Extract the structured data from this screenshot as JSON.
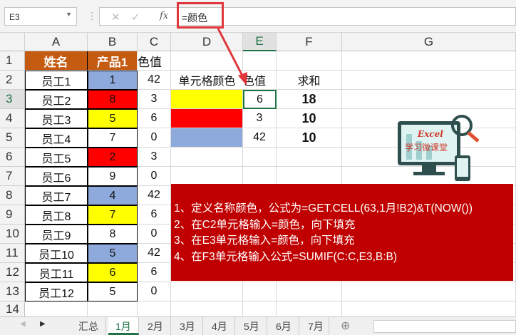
{
  "name_box": "E3",
  "formula": "=颜色",
  "columns": [
    "A",
    "B",
    "C",
    "D",
    "E",
    "F",
    "G"
  ],
  "rows": [
    "1",
    "2",
    "3",
    "4",
    "5",
    "6",
    "7",
    "8",
    "9",
    "10",
    "11",
    "12",
    "13",
    "14"
  ],
  "headers": {
    "name": "姓名",
    "product": "产品1",
    "color_value": "色值"
  },
  "employees": [
    {
      "name": "员工1",
      "product": "1",
      "color": "#8ea9db",
      "value": "42"
    },
    {
      "name": "员工2",
      "product": "8",
      "color": "#ff0000",
      "value": "3"
    },
    {
      "name": "员工3",
      "product": "5",
      "color": "#ffff00",
      "value": "6"
    },
    {
      "name": "员工4",
      "product": "7",
      "color": "",
      "value": "0"
    },
    {
      "name": "员工5",
      "product": "2",
      "color": "#ff0000",
      "value": "3"
    },
    {
      "name": "员工6",
      "product": "9",
      "color": "",
      "value": "0"
    },
    {
      "name": "员工7",
      "product": "4",
      "color": "#8ea9db",
      "value": "42"
    },
    {
      "name": "员工8",
      "product": "7",
      "color": "#ffff00",
      "value": "6"
    },
    {
      "name": "员工9",
      "product": "8",
      "color": "",
      "value": "0"
    },
    {
      "name": "员工10",
      "product": "5",
      "color": "#8ea9db",
      "value": "42"
    },
    {
      "name": "员工11",
      "product": "6",
      "color": "#ffff00",
      "value": "6"
    },
    {
      "name": "员工12",
      "product": "5",
      "color": "",
      "value": "0"
    }
  ],
  "summary": {
    "h_color": "单元格颜色",
    "h_value": "色值",
    "h_sum": "求和",
    "rows": [
      {
        "color": "#ffff00",
        "value": "6",
        "sum": "18"
      },
      {
        "color": "#ff0000",
        "value": "3",
        "sum": "10"
      },
      {
        "color": "#8ea9db",
        "value": "42",
        "sum": "10"
      }
    ]
  },
  "notes": [
    "1、定义名称颜色，公式为=GET.CELL(63,1月!B2)&T(NOW())",
    "2、在C2单元格输入=颜色，向下填充",
    "3、在E3单元格输入=颜色，向下填充",
    "4、在F3单元格输入公式=SUMIF(C:C,E3,B:B)"
  ],
  "logo": {
    "line1": "Excel",
    "line2": "学习微课堂"
  },
  "sheet_tabs": [
    "汇总",
    "1月",
    "2月",
    "3月",
    "4月",
    "5月",
    "6月",
    "7月"
  ],
  "active_tab": "1月"
}
